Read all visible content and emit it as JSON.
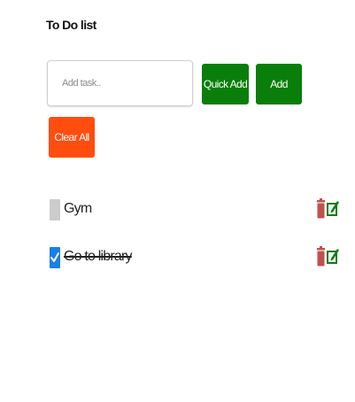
{
  "app": {
    "title": "To Do list"
  },
  "form": {
    "input_placeholder": "Add task..",
    "input_value": "",
    "quick_add_label": "Quick Add",
    "add_label": "Add",
    "clear_all_label": "Clear All"
  },
  "tasks": [
    {
      "label": "Gym",
      "completed": false
    },
    {
      "label": "Go to library",
      "completed": true
    }
  ],
  "colors": {
    "primary_button": "#0a7e0a",
    "danger_button": "#ff4c0f",
    "checkbox_checked": "#1a7fe8",
    "checkbox_unchecked": "#cccccc",
    "trash_icon": "#c0504d",
    "edit_icon": "#0a7e0a"
  },
  "icons": {
    "delete": "trash-icon",
    "edit": "edit-icon",
    "check": "checkmark-icon"
  }
}
